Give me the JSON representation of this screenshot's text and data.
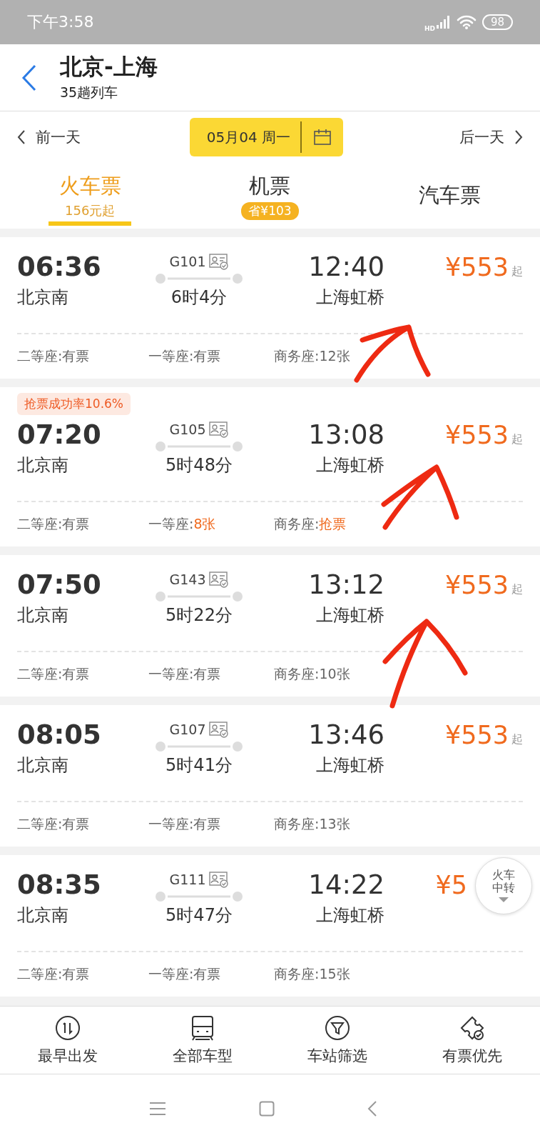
{
  "status_bar": {
    "time": "下午3:58",
    "network": "HD",
    "battery": "98"
  },
  "header": {
    "title": "北京-上海",
    "subtitle": "35趟列车"
  },
  "date_bar": {
    "prev": "前一天",
    "date": "05月04 周一",
    "next": "后一天"
  },
  "tabs": [
    {
      "label": "火车票",
      "sub": "156元起",
      "selected": true
    },
    {
      "label": "机票",
      "badge": "省¥103",
      "selected": false
    },
    {
      "label": "汽车票",
      "selected": false
    }
  ],
  "trains": [
    {
      "depart": "06:36",
      "from": "北京南",
      "number": "G101",
      "duration": "6时4分",
      "arrive": "12:40",
      "to": "上海虹桥",
      "price": "¥553",
      "price_suffix": "起",
      "seats": [
        {
          "label": "二等座:",
          "value": "有票",
          "highlight": false
        },
        {
          "label": "一等座:",
          "value": "有票",
          "highlight": false
        },
        {
          "label": "商务座:",
          "value": "12张",
          "highlight": false
        }
      ]
    },
    {
      "badge": "抢票成功率10.6%",
      "depart": "07:20",
      "from": "北京南",
      "number": "G105",
      "duration": "5时48分",
      "arrive": "13:08",
      "to": "上海虹桥",
      "price": "¥553",
      "price_suffix": "起",
      "seats": [
        {
          "label": "二等座:",
          "value": "有票",
          "highlight": false
        },
        {
          "label": "一等座:",
          "value": "8张",
          "highlight": true
        },
        {
          "label": "商务座:",
          "value": "抢票",
          "highlight": true
        }
      ]
    },
    {
      "depart": "07:50",
      "from": "北京南",
      "number": "G143",
      "duration": "5时22分",
      "arrive": "13:12",
      "to": "上海虹桥",
      "price": "¥553",
      "price_suffix": "起",
      "seats": [
        {
          "label": "二等座:",
          "value": "有票",
          "highlight": false
        },
        {
          "label": "一等座:",
          "value": "有票",
          "highlight": false
        },
        {
          "label": "商务座:",
          "value": "10张",
          "highlight": false
        }
      ]
    },
    {
      "depart": "08:05",
      "from": "北京南",
      "number": "G107",
      "duration": "5时41分",
      "arrive": "13:46",
      "to": "上海虹桥",
      "price": "¥553",
      "price_suffix": "起",
      "seats": [
        {
          "label": "二等座:",
          "value": "有票",
          "highlight": false
        },
        {
          "label": "一等座:",
          "value": "有票",
          "highlight": false
        },
        {
          "label": "商务座:",
          "value": "13张",
          "highlight": false
        }
      ]
    },
    {
      "depart": "08:35",
      "from": "北京南",
      "number": "G111",
      "duration": "5时47分",
      "arrive": "14:22",
      "to": "上海虹桥",
      "price": "¥5",
      "seats": [
        {
          "label": "二等座:",
          "value": "有票",
          "highlight": false
        },
        {
          "label": "一等座:",
          "value": "有票",
          "highlight": false
        },
        {
          "label": "商务座:",
          "value": "15张",
          "highlight": false
        }
      ]
    }
  ],
  "float_button": {
    "label": "火车中转"
  },
  "toolbar": [
    {
      "kind": "clock",
      "label": "最早出发"
    },
    {
      "kind": "train",
      "label": "全部车型"
    },
    {
      "kind": "filter",
      "label": "车站筛选"
    },
    {
      "kind": "ticket",
      "label": "有票优先"
    }
  ]
}
